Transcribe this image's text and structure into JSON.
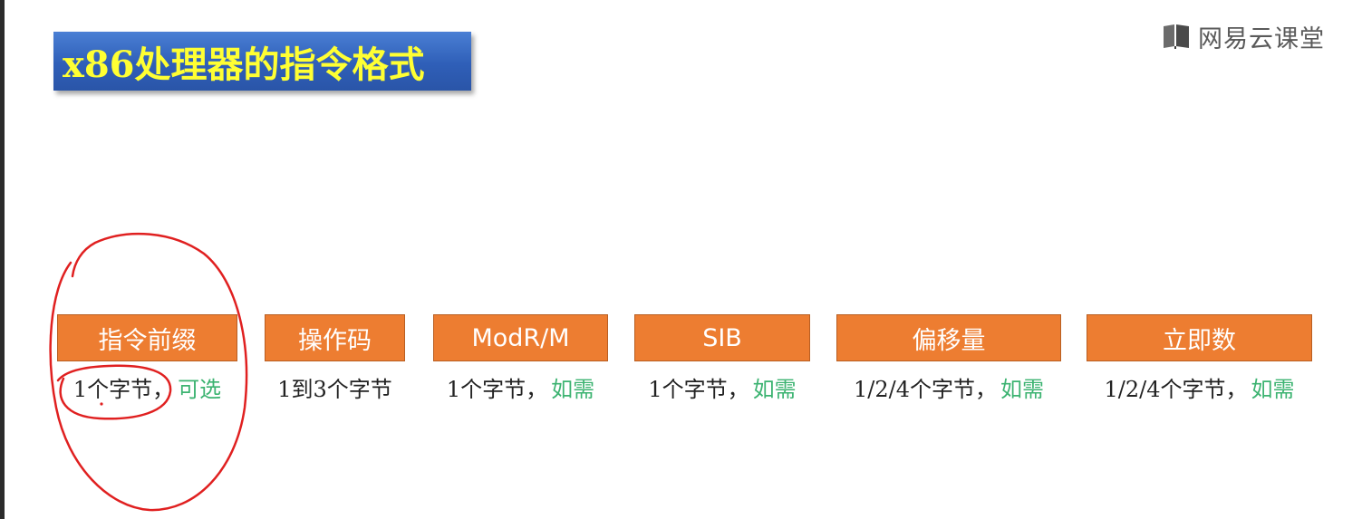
{
  "title": "x86处理器的指令格式",
  "logo": {
    "text": "网易云课堂",
    "icon": "book-icon"
  },
  "colors": {
    "title_bg": "#2f5fb8",
    "title_text": "#ffff33",
    "field_bg": "#ed7d31",
    "field_text": "#ffffff",
    "note_text": "#3cb371",
    "annotation": "#e02020"
  },
  "fields": [
    {
      "name": "指令前缀",
      "size": "1个字节，",
      "note": "可选"
    },
    {
      "name": "操作码",
      "size": "1到3个字节",
      "note": ""
    },
    {
      "name": "ModR/M",
      "size": "1个字节，",
      "note": "如需"
    },
    {
      "name": "SIB",
      "size": "1个字节，",
      "note": "如需"
    },
    {
      "name": "偏移量",
      "size": "1/2/4个字节，",
      "note": "如需"
    },
    {
      "name": "立即数",
      "size": "1/2/4个字节，",
      "note": "如需"
    }
  ]
}
